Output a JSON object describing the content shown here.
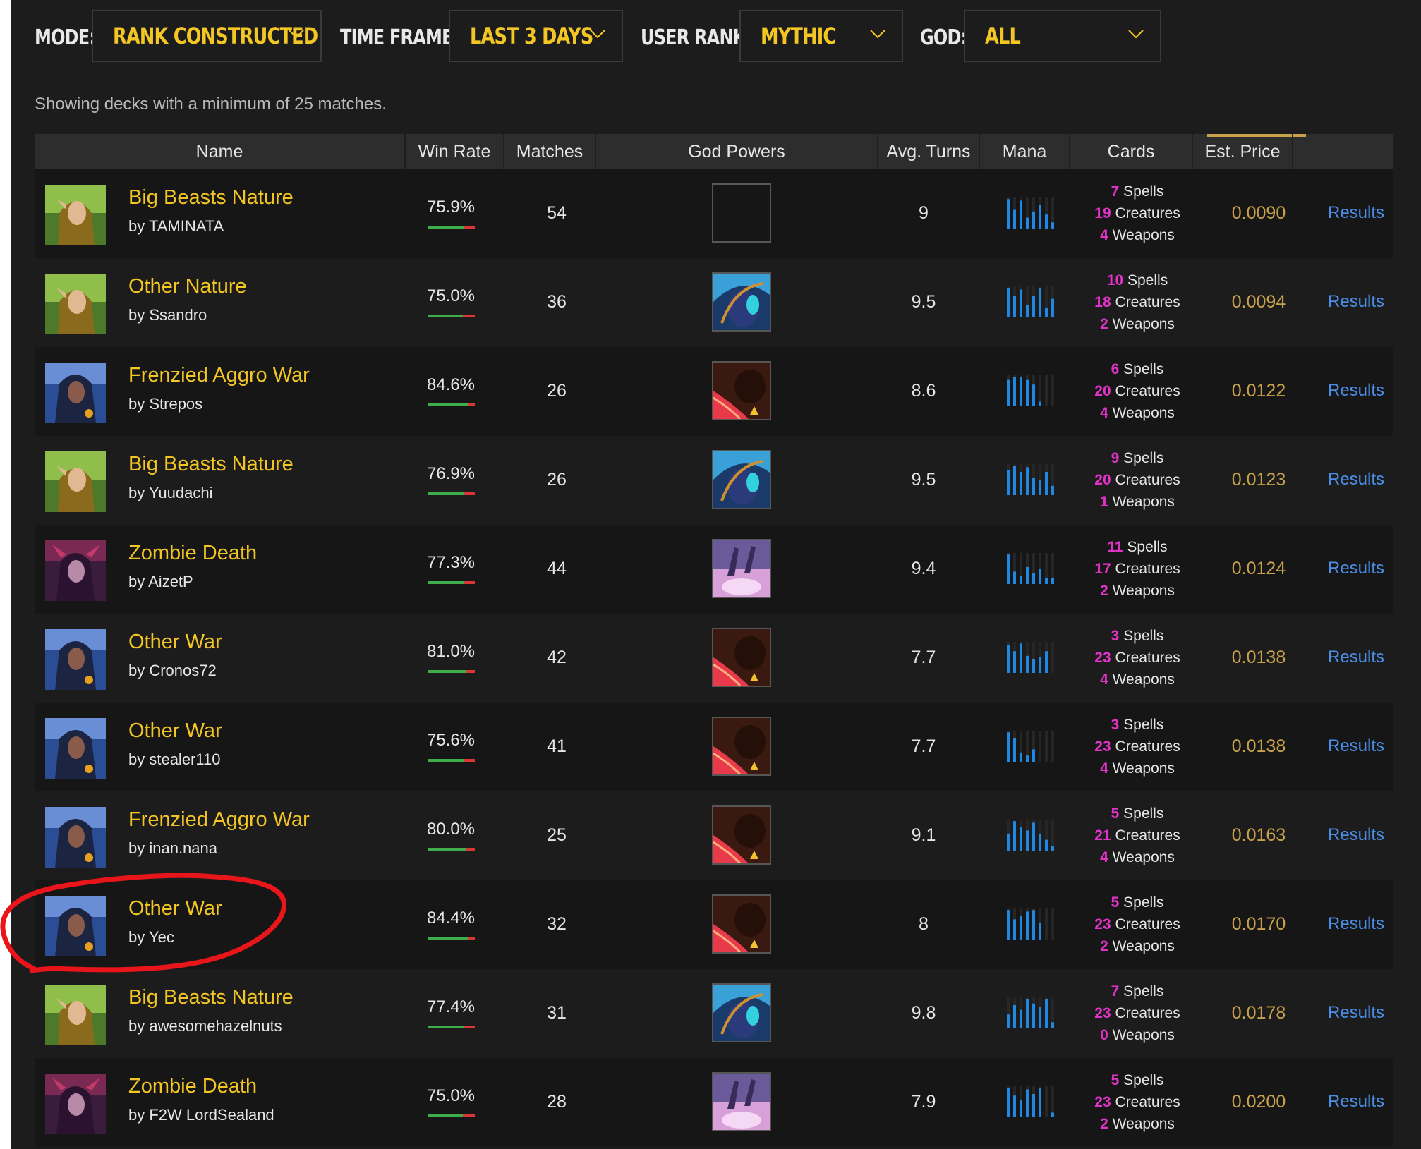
{
  "filters": {
    "mode": {
      "label": "MODE:",
      "value": "RANK CONSTRUCTED"
    },
    "time_frame": {
      "label": "TIME FRAME:",
      "value": "LAST 3 DAYS"
    },
    "user_rank": {
      "label": "USER RANK:",
      "value": "MYTHIC"
    },
    "god": {
      "label": "GOD:",
      "value": "ALL"
    }
  },
  "note": "Showing decks with a minimum of 25 matches.",
  "columns": {
    "name": "Name",
    "win_rate": "Win Rate",
    "matches": "Matches",
    "god_powers": "God Powers",
    "avg_turns": "Avg. Turns",
    "mana": "Mana",
    "cards": "Cards",
    "est_price": "Est. Price"
  },
  "card_labels": {
    "spells": "Spells",
    "creatures": "Creatures",
    "weapons": "Weapons"
  },
  "results_label": "Results",
  "colors": {
    "accent_gold": "#f3c623",
    "price_gold": "#c8a24a",
    "link_blue": "#4a8ee8",
    "card_count_magenta": "#e233c8",
    "win_green": "#3dae4a",
    "loss_red": "#d93636",
    "mana_blue": "#1e88e5",
    "annotation_red": "#e8151b"
  },
  "rows": [
    {
      "name": "Big Beasts Nature",
      "author": "by TAMINATA",
      "god": "nature",
      "win_rate": "75.9%",
      "win_pct": 75.9,
      "matches": "54",
      "god_power": "none",
      "avg_turns": "9",
      "mana": [
        0.95,
        0.6,
        0.9,
        0.35,
        0.55,
        0.75,
        0.45,
        0.2
      ],
      "spells": "7",
      "creatures": "19",
      "weapons": "4",
      "price": "0.0090"
    },
    {
      "name": "Other Nature",
      "author": "by Ssandro",
      "god": "nature",
      "win_rate": "75.0%",
      "win_pct": 75.0,
      "matches": "36",
      "god_power": "nature",
      "avg_turns": "9.5",
      "mana": [
        0.95,
        0.7,
        0.9,
        0.4,
        0.7,
        0.95,
        0.3,
        0.6
      ],
      "spells": "10",
      "creatures": "18",
      "weapons": "2",
      "price": "0.0094"
    },
    {
      "name": "Frenzied Aggro War",
      "author": "by Strepos",
      "god": "war",
      "win_rate": "84.6%",
      "win_pct": 84.6,
      "matches": "26",
      "god_power": "war",
      "avg_turns": "8.6",
      "mana": [
        0.85,
        0.95,
        0.95,
        0.85,
        0.7,
        0.15,
        0,
        0
      ],
      "spells": "6",
      "creatures": "20",
      "weapons": "4",
      "price": "0.0122"
    },
    {
      "name": "Big Beasts Nature",
      "author": "by Yuudachi",
      "god": "nature",
      "win_rate": "76.9%",
      "win_pct": 76.9,
      "matches": "26",
      "god_power": "nature",
      "avg_turns": "9.5",
      "mana": [
        0.8,
        0.95,
        0.75,
        0.9,
        0.55,
        0.5,
        0.75,
        0.3
      ],
      "spells": "9",
      "creatures": "20",
      "weapons": "1",
      "price": "0.0123"
    },
    {
      "name": "Zombie Death",
      "author": "by AizetP",
      "god": "death",
      "win_rate": "77.3%",
      "win_pct": 77.3,
      "matches": "44",
      "god_power": "death",
      "avg_turns": "9.4",
      "mana": [
        0.95,
        0.4,
        0.25,
        0.55,
        0.35,
        0.5,
        0.2,
        0.2
      ],
      "spells": "11",
      "creatures": "17",
      "weapons": "2",
      "price": "0.0124"
    },
    {
      "name": "Other War",
      "author": "by Cronos72",
      "god": "war",
      "win_rate": "81.0%",
      "win_pct": 81.0,
      "matches": "42",
      "god_power": "war",
      "avg_turns": "7.7",
      "mana": [
        0.9,
        0.7,
        0.95,
        0.55,
        0.45,
        0.5,
        0.7,
        0
      ],
      "spells": "3",
      "creatures": "23",
      "weapons": "4",
      "price": "0.0138"
    },
    {
      "name": "Other War",
      "author": "by stealer110",
      "god": "war",
      "win_rate": "75.6%",
      "win_pct": 75.6,
      "matches": "41",
      "god_power": "war",
      "avg_turns": "7.7",
      "mana": [
        0.95,
        0.75,
        0.3,
        0.2,
        0.4,
        0,
        0,
        0
      ],
      "spells": "3",
      "creatures": "23",
      "weapons": "4",
      "price": "0.0138"
    },
    {
      "name": "Frenzied Aggro War",
      "author": "by inan.nana",
      "god": "war",
      "win_rate": "80.0%",
      "win_pct": 80.0,
      "matches": "25",
      "god_power": "war",
      "avg_turns": "9.1",
      "mana": [
        0.55,
        0.95,
        0.75,
        0.65,
        0.9,
        0.55,
        0.35,
        0.15
      ],
      "spells": "5",
      "creatures": "21",
      "weapons": "4",
      "price": "0.0163"
    },
    {
      "name": "Other War",
      "author": "by Yec",
      "god": "war",
      "win_rate": "84.4%",
      "win_pct": 84.4,
      "matches": "32",
      "god_power": "war",
      "avg_turns": "8",
      "mana": [
        0.95,
        0.65,
        0.75,
        0.9,
        0.95,
        0.55,
        0,
        0
      ],
      "spells": "5",
      "creatures": "23",
      "weapons": "2",
      "price": "0.0170"
    },
    {
      "name": "Big Beasts Nature",
      "author": "by awesomehazelnuts",
      "god": "nature",
      "win_rate": "77.4%",
      "win_pct": 77.4,
      "matches": "31",
      "god_power": "nature",
      "avg_turns": "9.8",
      "mana": [
        0.45,
        0.75,
        0.6,
        0.95,
        0.8,
        0.7,
        0.95,
        0.2
      ],
      "spells": "7",
      "creatures": "23",
      "weapons": "0",
      "price": "0.0178"
    },
    {
      "name": "Zombie Death",
      "author": "by F2W LordSealand",
      "god": "death",
      "win_rate": "75.0%",
      "win_pct": 75.0,
      "matches": "28",
      "god_power": "death",
      "avg_turns": "7.9",
      "mana": [
        0.95,
        0.7,
        0.55,
        0.9,
        0.75,
        0.95,
        0,
        0.15
      ],
      "spells": "5",
      "creatures": "23",
      "weapons": "2",
      "price": "0.0200"
    }
  ]
}
